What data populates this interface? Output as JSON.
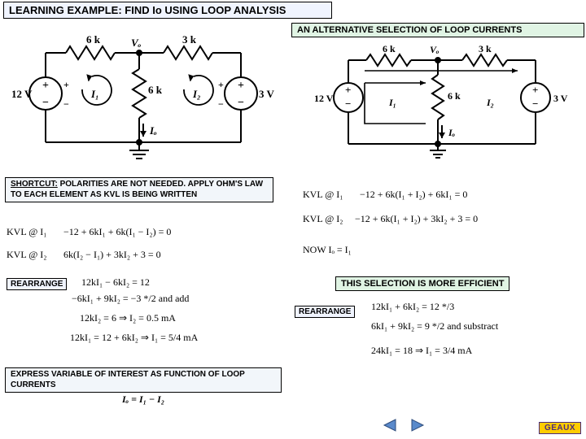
{
  "title": "LEARNING EXAMPLE: FIND Io USING LOOP ANALYSIS",
  "alt_title": "AN ALTERNATIVE SELECTION OF LOOP CURRENTS",
  "shortcut_note": "SHORTCUT: POLARITIES ARE NOT NEEDED. APPLY OHM'S LAW TO EACH ELEMENT AS KVL IS BEING WRITTEN",
  "rearrange_label": "REARRANGE",
  "efficient_label": "THIS SELECTION IS MORE EFFICIENT",
  "express_label": "EXPRESS VARIABLE OF INTEREST AS FUNCTION OF LOOP CURRENTS",
  "circuit_left": {
    "vs_left": "12 V",
    "vs_right": "3 V",
    "r_top_left": "6 k",
    "r_top_right": "3 k",
    "r_mid": "6 k",
    "vo": "Vₒ",
    "i1": "I₁",
    "i2": "I₂",
    "io": "Iₒ",
    "plus": "+",
    "minus": "−"
  },
  "circuit_right": {
    "vs_left": "12 V",
    "vs_right": "3 V",
    "r_top_left": "6 k",
    "r_top_right": "3 k",
    "r_mid": "6 k",
    "vo": "Vₒ",
    "i1": "I₁",
    "i2": "I₂",
    "io": "Iₒ",
    "plus": "+",
    "minus": "−"
  },
  "eq_left": {
    "kvl1_label": "KVL @ I₁",
    "kvl1": "−12 + 6kI₁ + 6k(I₁ − I₂) = 0",
    "kvl2_label": "KVL @ I₂",
    "kvl2": "6k(I₂ − I₁) + 3kI₂ + 3 = 0",
    "r1": "12kI₁ − 6kI₂ = 12",
    "r2": "−6kI₁ + 9kI₂ = −3 */2  and add",
    "r3": "12kI₂ = 6 ⇒ I₂ = 0.5 mA",
    "r4": "12kI₁ = 12 + 6kI₂ ⇒ I₁ = 5/4 mA",
    "io": "Iₒ = I₁ − I₂"
  },
  "eq_right": {
    "kvl1_label": "KVL @ I₁",
    "kvl1": "−12 + 6k(I₁ + I₂) + 6kI₁ = 0",
    "kvl2_label": "KVL @ I₂",
    "kvl2": "−12 + 6k(I₁ + I₂) + 3kI₂ + 3 = 0",
    "now": "NOW  Iₒ = I₁",
    "r1": "12kI₁ + 6kI₂ = 12 */3",
    "r2": "6kI₁ + 9kI₂ = 9  */2  and substract",
    "r3": "24kI₁ = 18 ⇒ I₁ = 3/4 mA"
  },
  "nav": {
    "prev": "◀",
    "next": "▶"
  },
  "footer_brand": "GEAUX"
}
